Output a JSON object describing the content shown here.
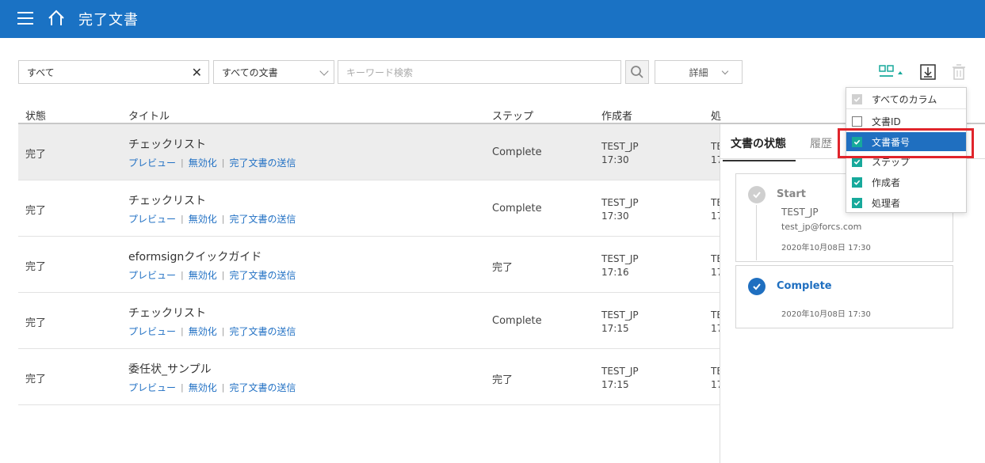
{
  "header": {
    "title": "完了文書"
  },
  "filters": {
    "category": "すべて",
    "doc_type": "すべての文書",
    "keyword_placeholder": "キーワード検索",
    "detail_label": "詳細"
  },
  "table": {
    "columns": {
      "status": "状態",
      "title": "タイトル",
      "step": "ステップ",
      "author": "作成者",
      "processor": "処"
    },
    "link_labels": {
      "preview": "プレビュー",
      "invalidate": "無効化",
      "send": "完了文書の送信"
    },
    "rows": [
      {
        "status": "完了",
        "title": "チェックリスト",
        "step": "Complete",
        "author": "TEST_JP",
        "time": "17:30",
        "proc1": "TE",
        "proc2": "17"
      },
      {
        "status": "完了",
        "title": "チェックリスト",
        "step": "Complete",
        "author": "TEST_JP",
        "time": "17:30",
        "proc1": "TE",
        "proc2": "17"
      },
      {
        "status": "完了",
        "title": "eformsignクイックガイド",
        "step": "完了",
        "author": "TEST_JP",
        "time": "17:16",
        "proc1": "TE",
        "proc2": "17"
      },
      {
        "status": "完了",
        "title": "チェックリスト",
        "step": "Complete",
        "author": "TEST_JP",
        "time": "17:15",
        "proc1": "TE",
        "proc2": "17"
      },
      {
        "status": "完了",
        "title": "委任状_サンプル",
        "step": "完了",
        "author": "TEST_JP",
        "time": "17:15",
        "proc1": "TE",
        "proc2": "17"
      }
    ]
  },
  "side_panel": {
    "tabs": [
      "文書の状態",
      "履歴"
    ],
    "cards": [
      {
        "step": "Start",
        "name": "TEST_JP",
        "email": "test_jp@forcs.com",
        "date": "2020年10月08日 17:30"
      },
      {
        "step": "Complete",
        "date": "2020年10月08日 17:30"
      }
    ]
  },
  "column_menu": {
    "items": [
      {
        "label": "すべてのカラム",
        "state": "disabled"
      },
      {
        "label": "文書ID",
        "state": "unchecked"
      },
      {
        "label": "文書番号",
        "state": "checked"
      },
      {
        "label": "ステップ",
        "state": "checked"
      },
      {
        "label": "作成者",
        "state": "checked"
      },
      {
        "label": "処理者",
        "state": "checked"
      }
    ]
  },
  "colors": {
    "header_bg": "#1a72c4",
    "link": "#2271c4",
    "checkbox": "#17a99b",
    "highlight": "#1f6fc0",
    "annotation": "#e0242b"
  }
}
